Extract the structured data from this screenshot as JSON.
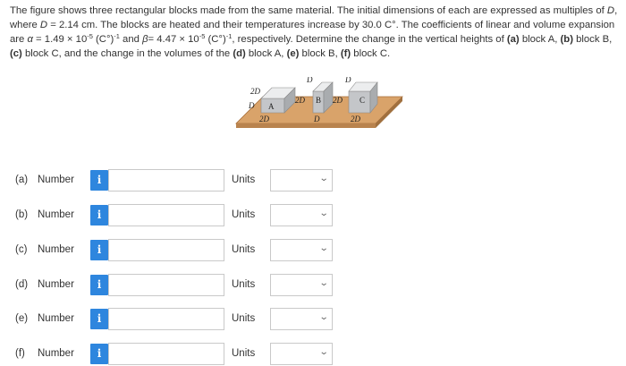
{
  "problem": {
    "s1": "The figure shows three rectangular blocks made from the same material. The initial dimensions of each are expressed as multiples of ",
    "s2": "D",
    "s3": ",",
    "s4": "where ",
    "s5": "D",
    "s6": " = 2.14 cm. The blocks are heated and their temperatures increase by 30.0 C°. The coefficients of linear and volume expansion",
    "s7": "are ",
    "s8": "α",
    "s9": " = 1.49 × 10",
    "s10": "-5",
    "s11": " (C°)",
    "s12": "-1",
    "s13": " and ",
    "s14": "β",
    "s15": "= 4.47 × 10",
    "s16": "-5",
    "s17": " (C°)",
    "s18": "-1",
    "s19": ", respectively. Determine the change in the vertical heights of ",
    "s20": "(a)",
    "s21": " block A, ",
    "s22": "(b)",
    "s23": " block B,",
    "s24": "(c)",
    "s25": " block C, and the change in the volumes of the ",
    "s26": "(d)",
    "s27": " block A, ",
    "s28": "(e)",
    "s29": " block B, ",
    "s30": "(f)",
    "s31": " block C."
  },
  "figure": {
    "labels": {
      "a_top": "2D",
      "a_left": "D",
      "a_name": "A",
      "a_bottom": "2D",
      "b_top": "D",
      "b_left": "2D",
      "b_name": "B",
      "b_bottom": "D",
      "c_top": "D",
      "c_left": "2D",
      "c_name": "C",
      "c_bottom": "2D"
    }
  },
  "answers": [
    {
      "part": "(a)",
      "number_label": "Number",
      "info_icon": "i",
      "value": "",
      "units_label": "Units",
      "unit_value": ""
    },
    {
      "part": "(b)",
      "number_label": "Number",
      "info_icon": "i",
      "value": "",
      "units_label": "Units",
      "unit_value": ""
    },
    {
      "part": "(c)",
      "number_label": "Number",
      "info_icon": "i",
      "value": "",
      "units_label": "Units",
      "unit_value": ""
    },
    {
      "part": "(d)",
      "number_label": "Number",
      "info_icon": "i",
      "value": "",
      "units_label": "Units",
      "unit_value": ""
    },
    {
      "part": "(e)",
      "number_label": "Number",
      "info_icon": "i",
      "value": "",
      "units_label": "Units",
      "unit_value": ""
    },
    {
      "part": "(f)",
      "number_label": "Number",
      "info_icon": "i",
      "value": "",
      "units_label": "Units",
      "unit_value": ""
    }
  ],
  "colors": {
    "info_button": "#2e86de",
    "board": "#d9a36a",
    "block": "#d4d6d8"
  }
}
